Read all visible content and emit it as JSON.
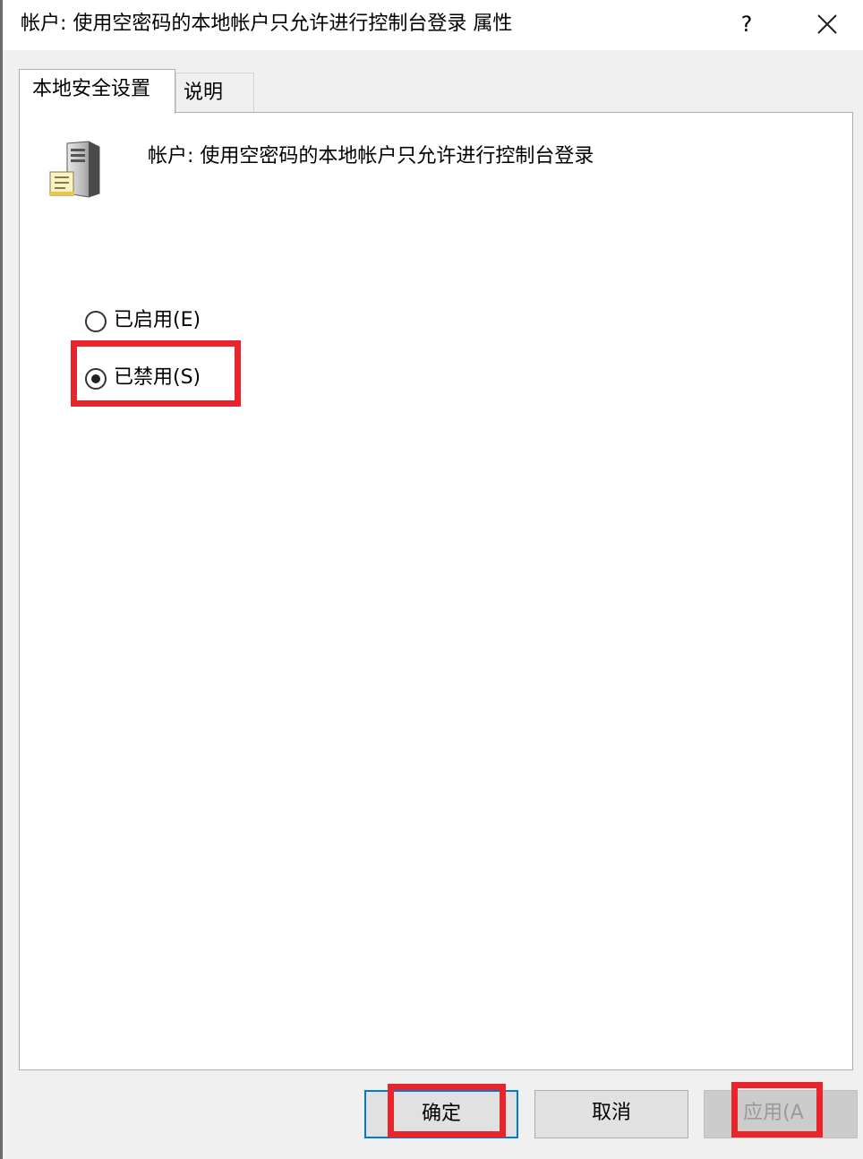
{
  "window": {
    "title": "帐户: 使用空密码的本地帐户只允许进行控制台登录 属性",
    "help_label": "?"
  },
  "tabs": [
    {
      "label": "本地安全设置",
      "active": true
    },
    {
      "label": "说明",
      "active": false
    }
  ],
  "policy": {
    "icon": "server-document-icon",
    "name": "帐户: 使用空密码的本地帐户只允许进行控制台登录"
  },
  "options": [
    {
      "label": "已启用(E)",
      "selected": false
    },
    {
      "label": "已禁用(S)",
      "selected": true
    }
  ],
  "buttons": {
    "ok": "确定",
    "cancel": "取消",
    "apply": "应用(A"
  },
  "colors": {
    "highlight": "#e8252a",
    "focus_border": "#0078d7"
  }
}
